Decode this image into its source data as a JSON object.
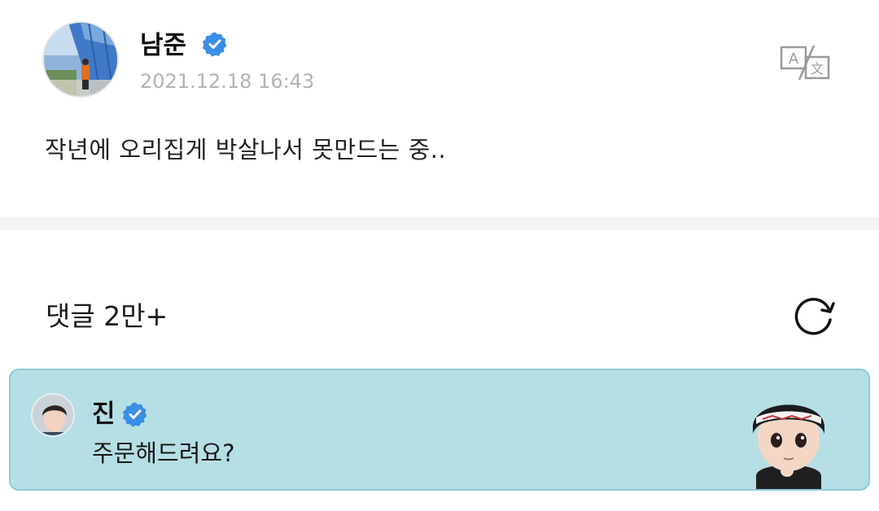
{
  "post": {
    "author": "남준",
    "date": "2021.12.18 16:43",
    "body": "작년에 오리집게 박살나서 못만드는 중.."
  },
  "comments": {
    "title": "댓글 2만+"
  },
  "pinned_comment": {
    "author": "진",
    "text": "주문해드려요?"
  },
  "icons": {
    "verified": "verified-badge-icon",
    "translate": "translate-icon",
    "refresh": "refresh-icon"
  },
  "colors": {
    "verified": "#3a8ee6",
    "pinned_bg": "#b6dfe5",
    "pinned_border": "#8ccbd6",
    "date": "#b3b3b3",
    "divider": "#f3f4f6"
  }
}
